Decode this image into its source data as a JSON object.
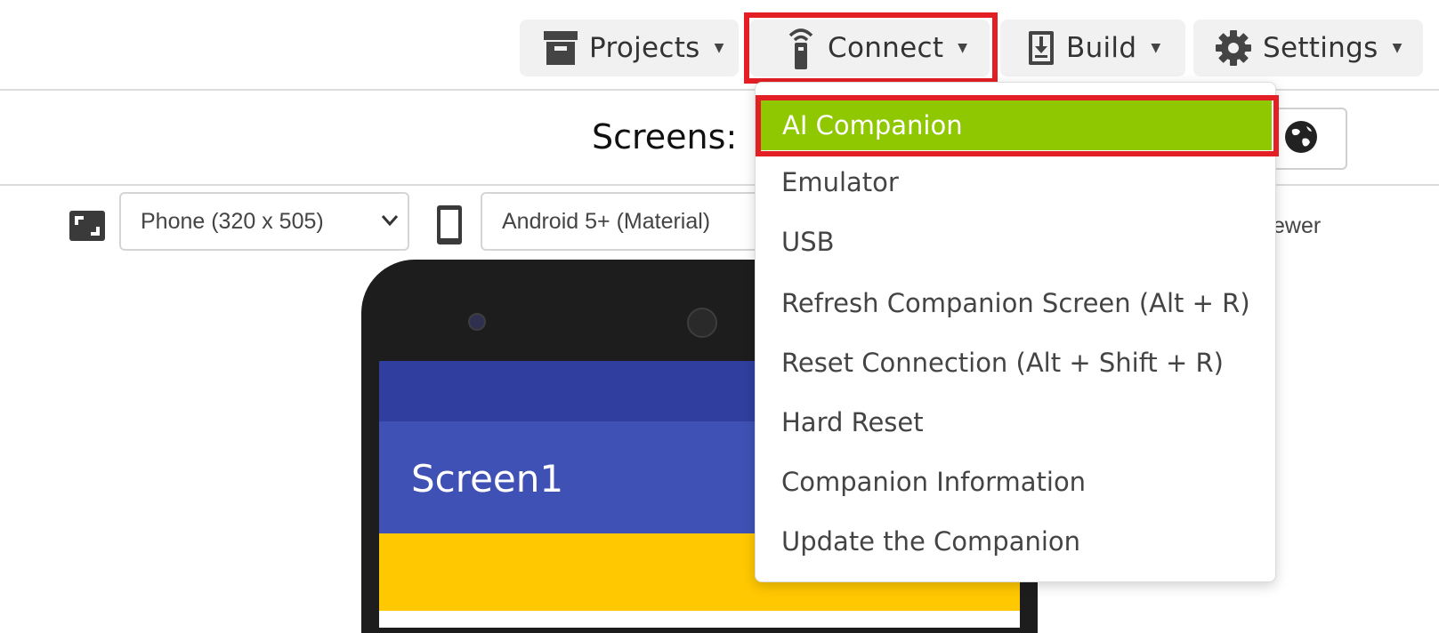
{
  "toolbar": {
    "projects_label": "Projects",
    "connect_label": "Connect",
    "build_label": "Build",
    "settings_label": "Settings",
    "icons": {
      "projects": "archive-box-icon",
      "connect": "wireless-signal-icon",
      "build": "download-box-icon",
      "settings": "gear-icon"
    }
  },
  "screens": {
    "label": "Screens:",
    "globe_icon": "globe-icon"
  },
  "designer": {
    "size_select_value": "Phone (320 x 505)",
    "theme_select_value": "Android 5+ (Material)",
    "viewer_text": "ewer"
  },
  "phone": {
    "screen_title": "Screen1"
  },
  "connect_menu": {
    "items": [
      {
        "label": "AI Companion"
      },
      {
        "label": "Emulator"
      },
      {
        "label": "USB"
      },
      {
        "label": "Refresh Companion Screen (Alt + R)"
      },
      {
        "label": "Reset Connection (Alt + Shift + R)"
      },
      {
        "label": "Hard Reset"
      },
      {
        "label": "Companion Information"
      },
      {
        "label": "Update the Companion"
      }
    ]
  },
  "colors": {
    "highlight_outline": "#e41e25",
    "menu_active_bg": "#8fc800",
    "status_bar": "#303f9f",
    "title_bar": "#3f51b5",
    "content_yellow": "#ffc800"
  }
}
